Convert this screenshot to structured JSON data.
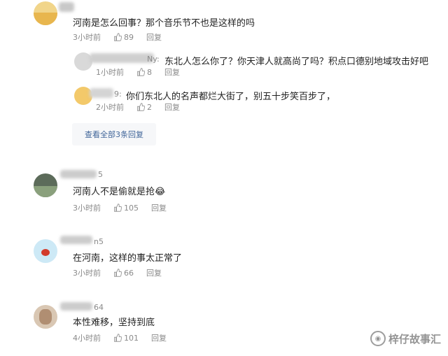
{
  "comments": [
    {
      "name_fragment": "",
      "content": "河南是怎么回事？那个音乐节不也是这样的吗",
      "time": "3小时前",
      "likes": "89",
      "reply": "回复",
      "replies": [
        {
          "name_fragment": "Ny:",
          "content": "东北人怎么你了？你天津人就高尚了吗？积点口德别地域攻击好吧",
          "time": "1小时前",
          "likes": "8",
          "reply": "回复"
        },
        {
          "name_fragment": "9:",
          "content": "你们东北人的名声都烂大街了，别五十步笑百步了，",
          "time": "2小时前",
          "likes": "2",
          "reply": "回复"
        }
      ],
      "view_all": "查看全部3条回复"
    },
    {
      "name_fragment": "5",
      "content": "河南人不是偷就是抢😂",
      "time": "3小时前",
      "likes": "105",
      "reply": "回复"
    },
    {
      "name_fragment": "n5",
      "content": "在河南，这样的事太正常了",
      "time": "3小时前",
      "likes": "66",
      "reply": "回复"
    },
    {
      "name_fragment": "64",
      "content": "本性难移，坚持到底",
      "time": "4小时前",
      "likes": "101",
      "reply": "回复"
    }
  ],
  "watermark": "梓仔故事汇"
}
